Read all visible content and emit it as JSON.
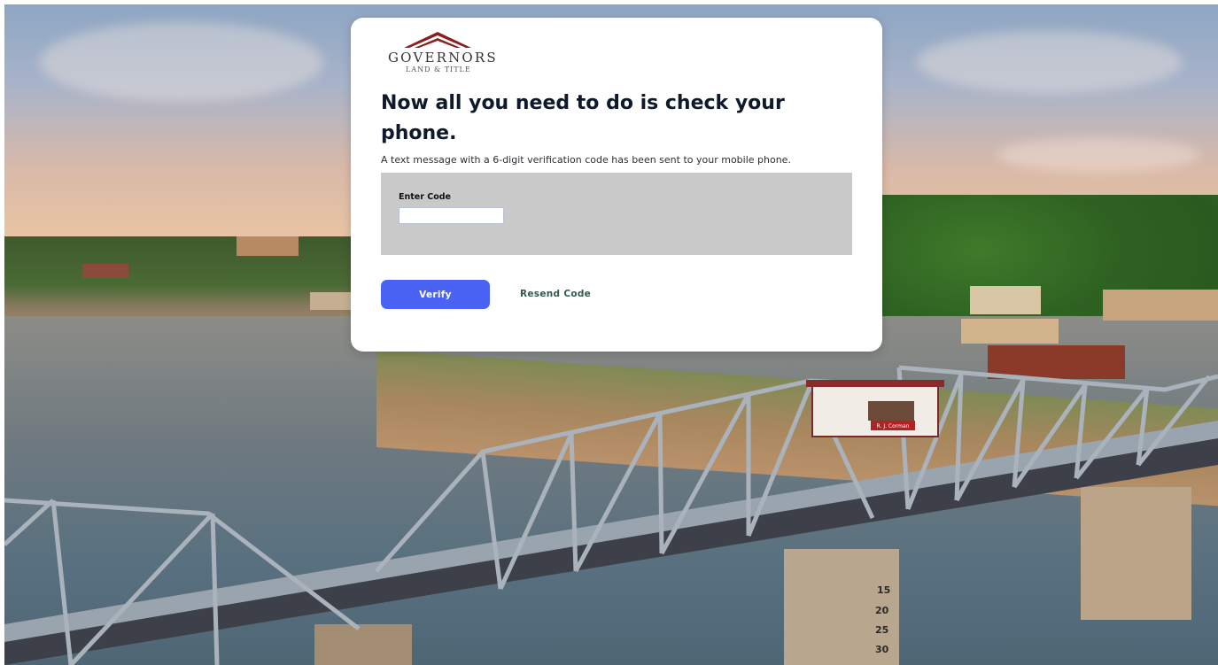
{
  "brand": {
    "logo_word": "GOVERNORS",
    "logo_sub": "LAND & TITLE",
    "roof_color": "#8a1f1f"
  },
  "verify": {
    "heading": "Now all you need to do is check your phone.",
    "subtitle": "A text message with a 6-digit verification code has been sent to your mobile phone.",
    "code_label": "Enter Code",
    "code_value": "",
    "verify_button": "Verify",
    "resend_link": "Resend Code"
  },
  "background": {
    "booth_sign": "R. J. Corman",
    "gauge_marks": [
      "15",
      "20",
      "25",
      "30"
    ]
  },
  "colors": {
    "accent": "#4a63f5",
    "link": "#2f5a4c",
    "panel": "#c9c9c9"
  }
}
